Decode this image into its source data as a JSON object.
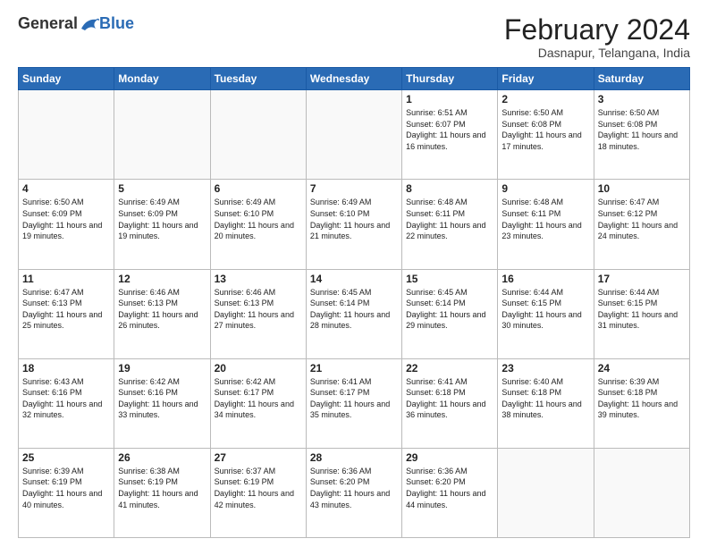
{
  "logo": {
    "general": "General",
    "blue": "Blue"
  },
  "title": {
    "month_year": "February 2024",
    "location": "Dasnapur, Telangana, India"
  },
  "days_of_week": [
    "Sunday",
    "Monday",
    "Tuesday",
    "Wednesday",
    "Thursday",
    "Friday",
    "Saturday"
  ],
  "weeks": [
    [
      {
        "day": "",
        "info": ""
      },
      {
        "day": "",
        "info": ""
      },
      {
        "day": "",
        "info": ""
      },
      {
        "day": "",
        "info": ""
      },
      {
        "day": "1",
        "info": "Sunrise: 6:51 AM\nSunset: 6:07 PM\nDaylight: 11 hours and 16 minutes."
      },
      {
        "day": "2",
        "info": "Sunrise: 6:50 AM\nSunset: 6:08 PM\nDaylight: 11 hours and 17 minutes."
      },
      {
        "day": "3",
        "info": "Sunrise: 6:50 AM\nSunset: 6:08 PM\nDaylight: 11 hours and 18 minutes."
      }
    ],
    [
      {
        "day": "4",
        "info": "Sunrise: 6:50 AM\nSunset: 6:09 PM\nDaylight: 11 hours and 19 minutes."
      },
      {
        "day": "5",
        "info": "Sunrise: 6:49 AM\nSunset: 6:09 PM\nDaylight: 11 hours and 19 minutes."
      },
      {
        "day": "6",
        "info": "Sunrise: 6:49 AM\nSunset: 6:10 PM\nDaylight: 11 hours and 20 minutes."
      },
      {
        "day": "7",
        "info": "Sunrise: 6:49 AM\nSunset: 6:10 PM\nDaylight: 11 hours and 21 minutes."
      },
      {
        "day": "8",
        "info": "Sunrise: 6:48 AM\nSunset: 6:11 PM\nDaylight: 11 hours and 22 minutes."
      },
      {
        "day": "9",
        "info": "Sunrise: 6:48 AM\nSunset: 6:11 PM\nDaylight: 11 hours and 23 minutes."
      },
      {
        "day": "10",
        "info": "Sunrise: 6:47 AM\nSunset: 6:12 PM\nDaylight: 11 hours and 24 minutes."
      }
    ],
    [
      {
        "day": "11",
        "info": "Sunrise: 6:47 AM\nSunset: 6:13 PM\nDaylight: 11 hours and 25 minutes."
      },
      {
        "day": "12",
        "info": "Sunrise: 6:46 AM\nSunset: 6:13 PM\nDaylight: 11 hours and 26 minutes."
      },
      {
        "day": "13",
        "info": "Sunrise: 6:46 AM\nSunset: 6:13 PM\nDaylight: 11 hours and 27 minutes."
      },
      {
        "day": "14",
        "info": "Sunrise: 6:45 AM\nSunset: 6:14 PM\nDaylight: 11 hours and 28 minutes."
      },
      {
        "day": "15",
        "info": "Sunrise: 6:45 AM\nSunset: 6:14 PM\nDaylight: 11 hours and 29 minutes."
      },
      {
        "day": "16",
        "info": "Sunrise: 6:44 AM\nSunset: 6:15 PM\nDaylight: 11 hours and 30 minutes."
      },
      {
        "day": "17",
        "info": "Sunrise: 6:44 AM\nSunset: 6:15 PM\nDaylight: 11 hours and 31 minutes."
      }
    ],
    [
      {
        "day": "18",
        "info": "Sunrise: 6:43 AM\nSunset: 6:16 PM\nDaylight: 11 hours and 32 minutes."
      },
      {
        "day": "19",
        "info": "Sunrise: 6:42 AM\nSunset: 6:16 PM\nDaylight: 11 hours and 33 minutes."
      },
      {
        "day": "20",
        "info": "Sunrise: 6:42 AM\nSunset: 6:17 PM\nDaylight: 11 hours and 34 minutes."
      },
      {
        "day": "21",
        "info": "Sunrise: 6:41 AM\nSunset: 6:17 PM\nDaylight: 11 hours and 35 minutes."
      },
      {
        "day": "22",
        "info": "Sunrise: 6:41 AM\nSunset: 6:18 PM\nDaylight: 11 hours and 36 minutes."
      },
      {
        "day": "23",
        "info": "Sunrise: 6:40 AM\nSunset: 6:18 PM\nDaylight: 11 hours and 38 minutes."
      },
      {
        "day": "24",
        "info": "Sunrise: 6:39 AM\nSunset: 6:18 PM\nDaylight: 11 hours and 39 minutes."
      }
    ],
    [
      {
        "day": "25",
        "info": "Sunrise: 6:39 AM\nSunset: 6:19 PM\nDaylight: 11 hours and 40 minutes."
      },
      {
        "day": "26",
        "info": "Sunrise: 6:38 AM\nSunset: 6:19 PM\nDaylight: 11 hours and 41 minutes."
      },
      {
        "day": "27",
        "info": "Sunrise: 6:37 AM\nSunset: 6:19 PM\nDaylight: 11 hours and 42 minutes."
      },
      {
        "day": "28",
        "info": "Sunrise: 6:36 AM\nSunset: 6:20 PM\nDaylight: 11 hours and 43 minutes."
      },
      {
        "day": "29",
        "info": "Sunrise: 6:36 AM\nSunset: 6:20 PM\nDaylight: 11 hours and 44 minutes."
      },
      {
        "day": "",
        "info": ""
      },
      {
        "day": "",
        "info": ""
      }
    ]
  ]
}
